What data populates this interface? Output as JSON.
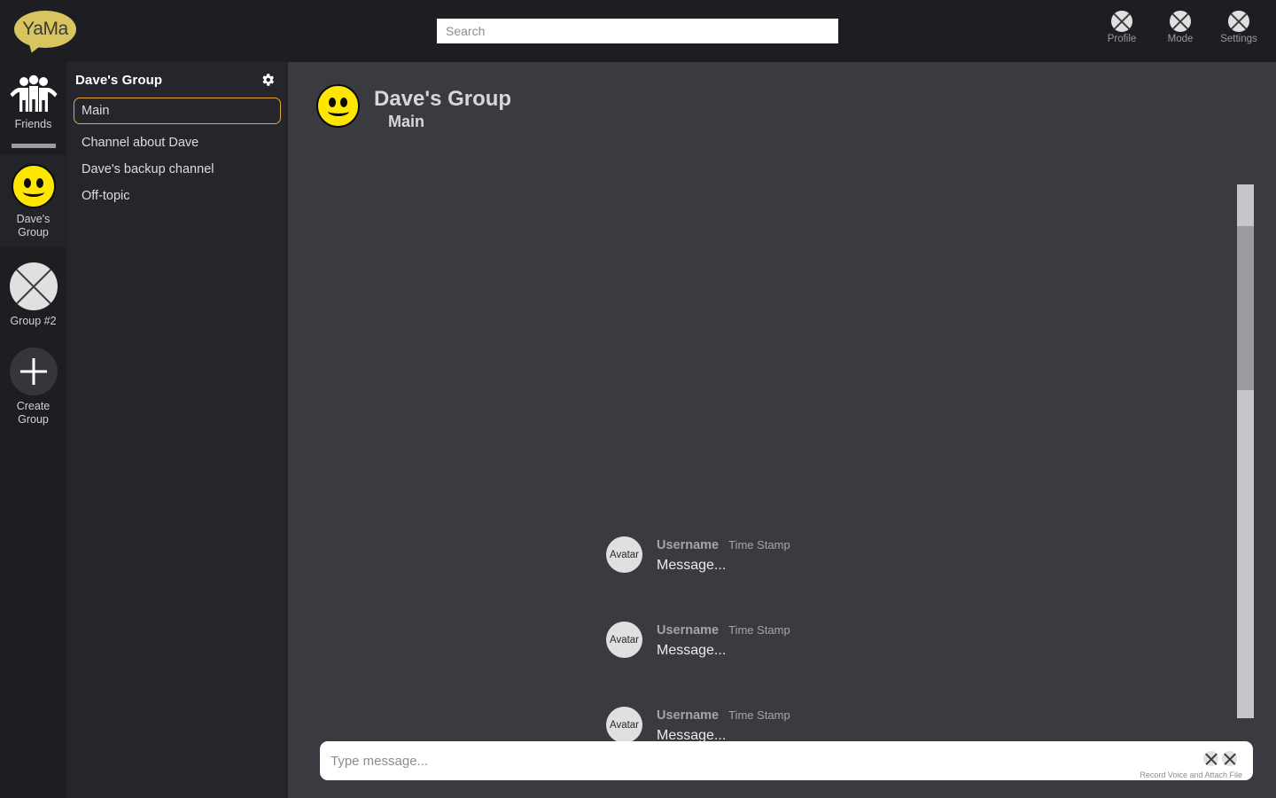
{
  "app": {
    "logo_text": "YaMa",
    "accent_color": "#e8a33d",
    "brand_color": "#d8c55f",
    "smiley_color": "#ffe600"
  },
  "topbar": {
    "search": {
      "placeholder": "Search",
      "value": ""
    },
    "actions": [
      {
        "label": "Profile",
        "icon": "circle-x-icon"
      },
      {
        "label": "Mode",
        "icon": "circle-x-icon"
      },
      {
        "label": "Settings",
        "icon": "circle-x-icon"
      }
    ]
  },
  "rail": {
    "items": [
      {
        "label": "Friends",
        "icon": "friends-icon",
        "active": false
      },
      {
        "label": "Dave's Group",
        "icon": "smiley-icon",
        "active": true
      },
      {
        "label": "Group #2",
        "icon": "circle-x-icon",
        "active": false
      },
      {
        "label": "Create Group",
        "icon": "plus-icon",
        "active": false
      }
    ]
  },
  "channel_panel": {
    "group_title": "Dave's Group",
    "settings_icon": "gear-icon",
    "channels": [
      {
        "name": "Main",
        "selected": true
      },
      {
        "name": "Channel about Dave",
        "selected": false
      },
      {
        "name": "Dave's backup channel",
        "selected": false
      },
      {
        "name": "Off-topic",
        "selected": false
      }
    ]
  },
  "chat": {
    "header": {
      "avatar_icon": "smiley-icon",
      "title": "Dave's Group",
      "subtitle": "Main"
    },
    "messages": [
      {
        "avatar_label": "Avatar",
        "username": "Username",
        "timestamp": "Time Stamp",
        "text": "Message..."
      },
      {
        "avatar_label": "Avatar",
        "username": "Username",
        "timestamp": "Time Stamp",
        "text": "Message..."
      },
      {
        "avatar_label": "Avatar",
        "username": "Username",
        "timestamp": "Time Stamp",
        "text": "Message..."
      }
    ],
    "composer": {
      "placeholder": "Type message...",
      "value": "",
      "caption": "Record Voice and Attach File",
      "actions": [
        {
          "name": "record-voice-button",
          "icon": "circle-x-icon"
        },
        {
          "name": "attach-file-button",
          "icon": "circle-x-icon"
        }
      ]
    }
  }
}
